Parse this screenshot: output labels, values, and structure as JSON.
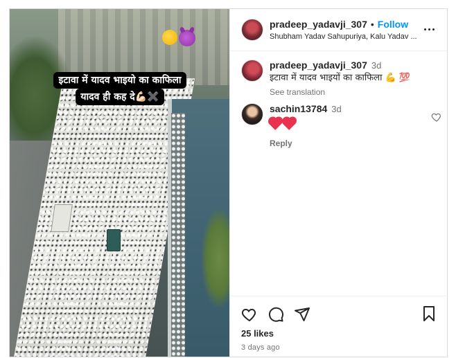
{
  "post": {
    "overlay": {
      "line1": "इटावा में यादव भाइयो का काफिला",
      "line2": "यादव ही कह दे💪🏻✖️"
    },
    "header": {
      "username": "pradeep_yadavji_307",
      "separator": "•",
      "follow_label": "Follow",
      "subtitle": "Shubham Yadav Sahupuriya, Kalu Yadav ..."
    },
    "caption": {
      "username": "pradeep_yadavji_307",
      "time": "3d",
      "text": "इटावा में यादव भाइयों का काफिला 💪 💯",
      "see_translation": "See translation"
    },
    "comments": [
      {
        "username": "sachin13784",
        "time": "3d",
        "text": "❤️❤️",
        "reply_label": "Reply"
      }
    ],
    "likes": "25 likes",
    "posted_ago": "3 days ago"
  },
  "icons": {
    "more": "more-options-icon",
    "like": "heart-icon",
    "comment": "comment-icon",
    "share": "share-icon",
    "save": "bookmark-icon"
  },
  "colors": {
    "follow": "#0095f6",
    "heart": "#e8334f",
    "muted": "#737373"
  }
}
